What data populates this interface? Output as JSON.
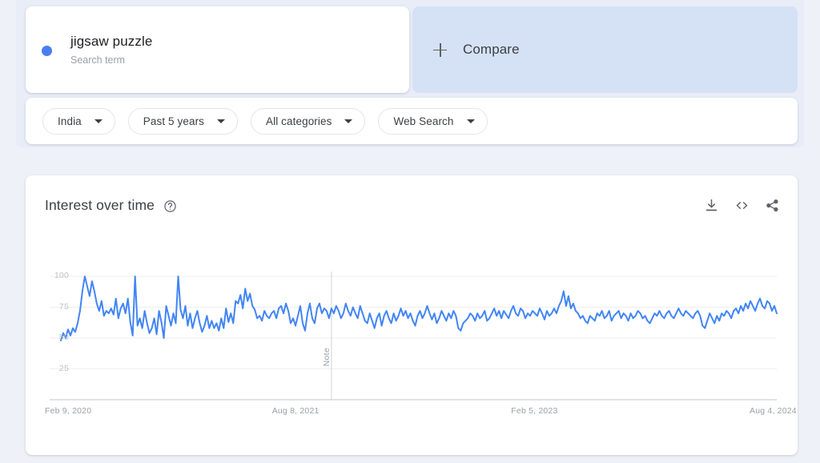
{
  "page": {
    "background_color": "#eef1f7",
    "panel_color": "#e8edf8"
  },
  "search_term_card": {
    "dot_color": "#4a7ef0",
    "term": "jigsaw puzzle",
    "subtitle": "Search term",
    "dot_icon": "series-color-dot"
  },
  "compare_card": {
    "plus_icon": "plus-icon",
    "label": "Compare",
    "background_color": "#d5e1f5"
  },
  "filters": [
    {
      "name": "location",
      "label": "India"
    },
    {
      "name": "time-range",
      "label": "Past 5 years"
    },
    {
      "name": "category",
      "label": "All categories"
    },
    {
      "name": "search-type",
      "label": "Web Search"
    }
  ],
  "chart_card": {
    "title": "Interest over time",
    "help_icon": "help-circle-icon",
    "actions": [
      {
        "name": "download",
        "icon": "download-icon"
      },
      {
        "name": "embed",
        "icon": "code-embed-icon"
      },
      {
        "name": "share",
        "icon": "share-icon"
      }
    ]
  },
  "chart_data": {
    "type": "line",
    "title": "Interest over time",
    "xlabel": "",
    "ylabel": "",
    "ylim": [
      0,
      100
    ],
    "yticks": [
      25,
      50,
      75,
      100
    ],
    "ytick_labels": [
      "25",
      "75",
      "50",
      "100"
    ],
    "grid": true,
    "legend": "none",
    "line_color": "#4285f4",
    "line_width": 2,
    "x_tick_labels": [
      "Feb 9, 2020",
      "Aug 8, 2021",
      "Feb 5, 2023",
      "Aug 4, 2024"
    ],
    "x_tick_positions": [
      0,
      0.333,
      0.667,
      1.0
    ],
    "annotations": [
      {
        "label": "Note",
        "x_fraction": 0.378,
        "type": "vertical-line"
      }
    ],
    "series": [
      {
        "name": "jigsaw puzzle",
        "color": "#4285f4",
        "values": [
          48,
          54,
          50,
          57,
          52,
          58,
          55,
          62,
          72,
          88,
          100,
          92,
          84,
          96,
          88,
          78,
          72,
          80,
          68,
          72,
          70,
          74,
          69,
          82,
          66,
          74,
          78,
          70,
          82,
          63,
          52,
          100,
          60,
          66,
          58,
          72,
          62,
          54,
          58,
          66,
          53,
          72,
          63,
          50,
          76,
          68,
          60,
          70,
          62,
          100,
          73,
          66,
          76,
          60,
          70,
          58,
          66,
          72,
          62,
          55,
          60,
          68,
          58,
          64,
          58,
          62,
          56,
          66,
          58,
          74,
          63,
          70,
          62,
          80,
          78,
          85,
          74,
          90,
          80,
          86,
          76,
          73,
          66,
          68,
          64,
          72,
          68,
          66,
          70,
          72,
          66,
          74,
          76,
          70,
          78,
          72,
          62,
          66,
          60,
          68,
          76,
          62,
          56,
          70,
          78,
          66,
          62,
          74,
          78,
          70,
          74,
          72,
          66,
          74,
          70,
          76,
          72,
          66,
          70,
          78,
          72,
          68,
          75,
          70,
          66,
          76,
          70,
          64,
          62,
          70,
          64,
          58,
          66,
          70,
          60,
          68,
          72,
          66,
          62,
          70,
          64,
          68,
          74,
          68,
          72,
          66,
          70,
          64,
          60,
          68,
          72,
          66,
          70,
          76,
          70,
          65,
          70,
          62,
          66,
          72,
          68,
          64,
          70,
          66,
          72,
          68,
          58,
          56,
          62,
          64,
          66,
          70,
          68,
          64,
          70,
          66,
          68,
          72,
          64,
          66,
          70,
          74,
          68,
          72,
          66,
          72,
          69,
          66,
          72,
          76,
          70,
          68,
          74,
          72,
          66,
          70,
          68,
          72,
          70,
          68,
          74,
          70,
          65,
          72,
          68,
          70,
          74,
          70,
          76,
          80,
          88,
          76,
          84,
          74,
          78,
          72,
          70,
          66,
          68,
          64,
          62,
          68,
          66,
          64,
          70,
          68,
          72,
          66,
          68,
          72,
          64,
          68,
          70,
          72,
          66,
          70,
          68,
          64,
          70,
          66,
          68,
          72,
          70,
          66,
          68,
          64,
          62,
          66,
          70,
          68,
          72,
          68,
          66,
          70,
          72,
          68,
          66,
          70,
          74,
          70,
          68,
          72,
          70,
          68,
          66,
          70,
          72,
          68,
          60,
          58,
          64,
          70,
          66,
          62,
          68,
          64,
          70,
          68,
          72,
          70,
          66,
          72,
          74,
          70,
          76,
          72,
          78,
          74,
          80,
          76,
          72,
          78,
          82,
          76,
          74,
          80,
          78,
          72,
          76,
          70
        ]
      }
    ]
  }
}
